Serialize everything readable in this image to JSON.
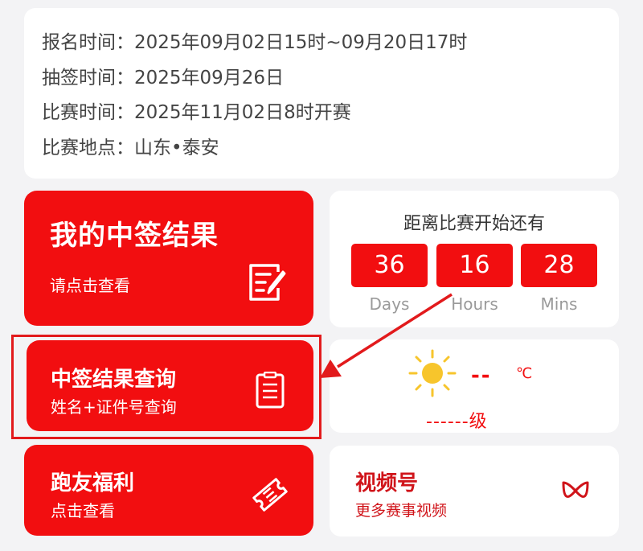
{
  "info": {
    "lines": [
      {
        "label": "报名时间：",
        "value": "2025年09月02日15时~09月20日17时"
      },
      {
        "label": "抽签时间：",
        "value": "2025年09月26日"
      },
      {
        "label": "比赛时间：",
        "value": "2025年11月02日8时开赛"
      },
      {
        "label": "比赛地点：",
        "value": "山东•泰安"
      }
    ]
  },
  "result_card": {
    "title": "我的中签结果",
    "subtitle": "请点击查看",
    "icon": "edit-note-icon"
  },
  "query_card": {
    "title": "中签结果查询",
    "subtitle": "姓名+证件号查询",
    "icon": "clipboard-icon"
  },
  "benefit_card": {
    "title": "跑友福利",
    "subtitle": "点击查看",
    "icon": "ticket-icon"
  },
  "countdown": {
    "heading": "距离比赛开始还有",
    "days": "36",
    "hours": "16",
    "mins": "28",
    "days_label": "Days",
    "hours_label": "Hours",
    "mins_label": "Mins"
  },
  "weather": {
    "temp": "--",
    "unit": "℃",
    "wind": "------级",
    "icon": "sun-icon"
  },
  "video_card": {
    "title": "视频号",
    "subtitle": "更多赛事视频",
    "icon": "wechat-channels-icon"
  },
  "colors": {
    "accent": "#f20e10",
    "background": "#f3f3f5",
    "annotation": "#e21a1c",
    "sun": "#f7c52c"
  }
}
